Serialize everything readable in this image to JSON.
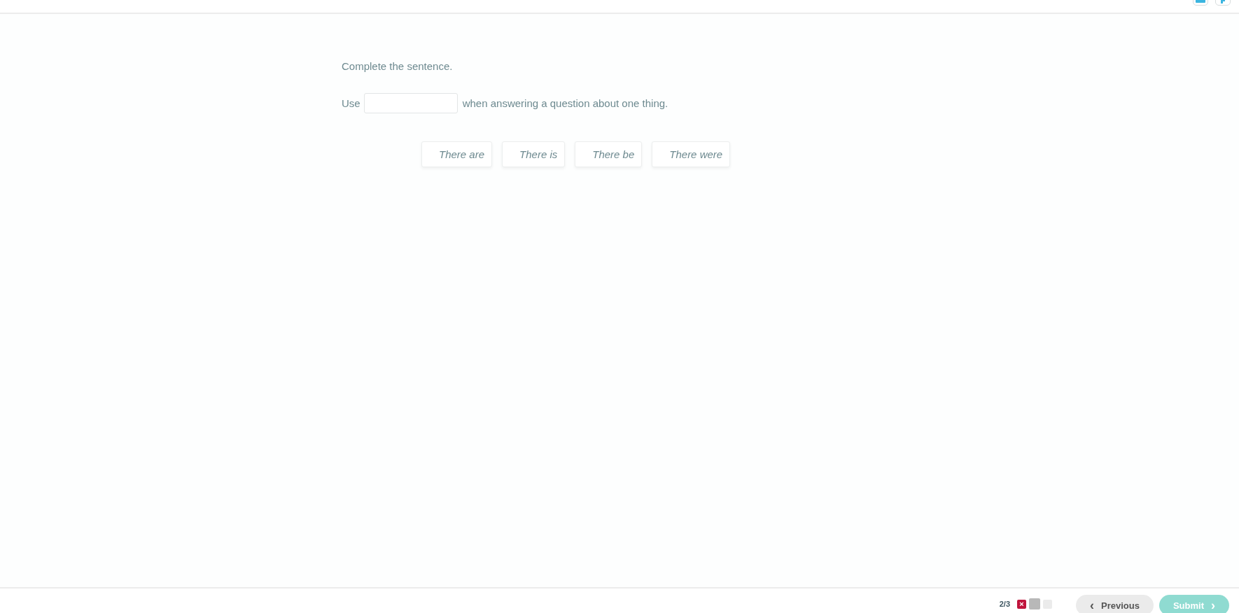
{
  "question": {
    "instruction": "Complete the sentence.",
    "before_blank": "Use",
    "after_blank": "when answering a question about one thing."
  },
  "options": [
    {
      "label": "There are"
    },
    {
      "label": "There is"
    },
    {
      "label": "There be"
    },
    {
      "label": "There were"
    }
  ],
  "footer": {
    "progress": "2/3",
    "steps": [
      {
        "kind": "wrong",
        "mark": "×"
      },
      {
        "kind": "current"
      },
      {
        "kind": "todo"
      }
    ],
    "previous": {
      "label": "Previous",
      "icon": "‹"
    },
    "submit": {
      "label": "Submit",
      "icon": "›",
      "disabled": true
    }
  }
}
